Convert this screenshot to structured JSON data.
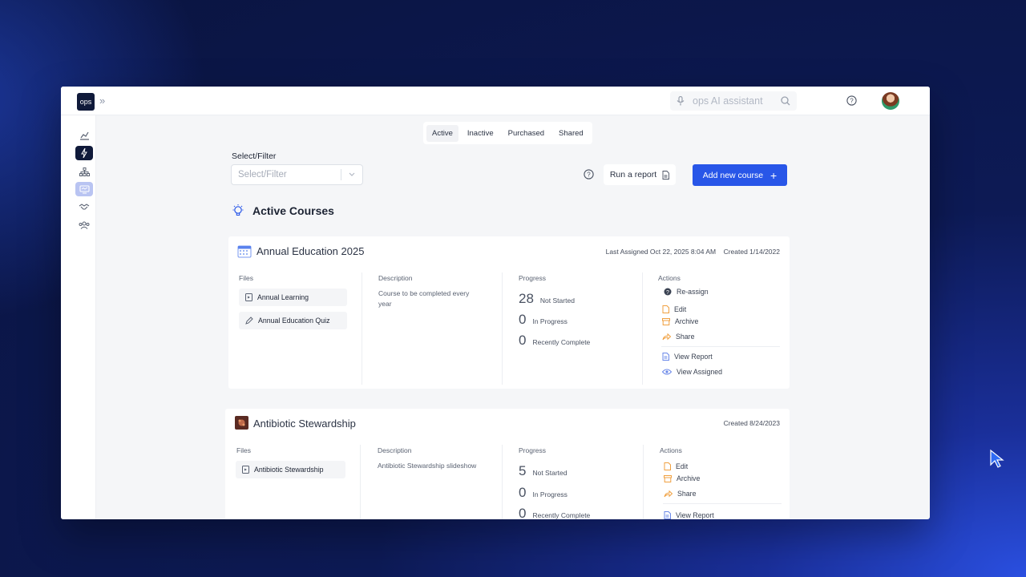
{
  "app": {
    "logo": "ops",
    "ai_placeholder": "ops AI assistant"
  },
  "sidebar": {
    "items": [
      {
        "icon": "dashboard-chart-icon"
      },
      {
        "icon": "lightning-icon"
      },
      {
        "icon": "org-chart-icon"
      },
      {
        "icon": "courses-icon"
      },
      {
        "icon": "handshake-icon"
      },
      {
        "icon": "team-icon"
      }
    ]
  },
  "tabs": [
    "Active",
    "Inactive",
    "Purchased",
    "Shared"
  ],
  "filter": {
    "label": "Select/Filter",
    "placeholder": "Select/Filter"
  },
  "buttons": {
    "run_report": "Run a report",
    "add_course": "Add new course"
  },
  "section_title": "Active Courses",
  "column_labels": {
    "files": "Files",
    "description": "Description",
    "progress": "Progress",
    "actions": "Actions"
  },
  "courses": [
    {
      "title": "Annual Education 2025",
      "last_assigned": "Last Assigned Oct 22, 2025 8:04 AM",
      "created": "Created 1/14/2022",
      "files": [
        "Annual Learning",
        "Annual Education Quiz"
      ],
      "description": "Course to be completed every year",
      "progress": [
        {
          "value": "28",
          "label": "Not Started"
        },
        {
          "value": "0",
          "label": "In Progress"
        },
        {
          "value": "0",
          "label": "Recently Complete"
        }
      ],
      "actions": [
        "Re-assign",
        "Edit",
        "Archive",
        "Share",
        "View Report",
        "View Assigned"
      ]
    },
    {
      "title": "Antibiotic Stewardship",
      "created": "Created 8/24/2023",
      "files": [
        "Antibiotic Stewardship"
      ],
      "description": "Antibiotic Stewardship slideshow",
      "progress": [
        {
          "value": "5",
          "label": "Not Started"
        },
        {
          "value": "0",
          "label": "In Progress"
        },
        {
          "value": "0",
          "label": "Recently Complete"
        }
      ],
      "actions": [
        "Edit",
        "Archive",
        "Share",
        "View Report"
      ]
    }
  ],
  "colors": {
    "primary": "#2856e8",
    "sidebar_active": "#b9c4f2",
    "logo_bg": "#101a3a",
    "accent_orange": "#f0a040"
  }
}
